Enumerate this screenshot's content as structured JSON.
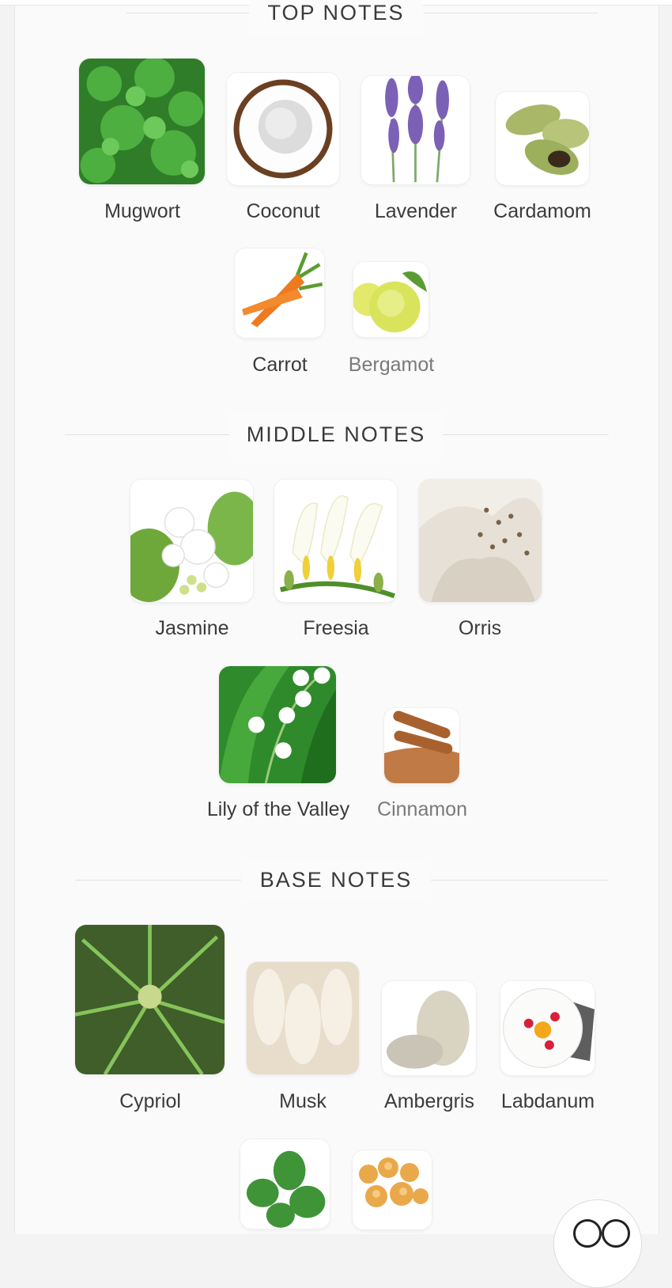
{
  "sections": {
    "top": {
      "title": "TOP NOTES",
      "notes": [
        {
          "name": "Mugwort",
          "icon": "mugwort-image"
        },
        {
          "name": "Coconut",
          "icon": "coconut-image"
        },
        {
          "name": "Lavender",
          "icon": "lavender-image"
        },
        {
          "name": "Cardamom",
          "icon": "cardamom-image"
        },
        {
          "name": "Carrot",
          "icon": "carrot-image"
        },
        {
          "name": "Bergamot",
          "icon": "bergamot-image"
        }
      ]
    },
    "middle": {
      "title": "MIDDLE NOTES",
      "notes": [
        {
          "name": "Jasmine",
          "icon": "jasmine-image"
        },
        {
          "name": "Freesia",
          "icon": "freesia-image"
        },
        {
          "name": "Orris",
          "icon": "orris-image"
        },
        {
          "name": "Lily of the Valley",
          "icon": "lily-of-the-valley-image"
        },
        {
          "name": "Cinnamon",
          "icon": "cinnamon-image"
        }
      ]
    },
    "base": {
      "title": "BASE NOTES",
      "notes": [
        {
          "name": "Cypriol",
          "icon": "cypriol-image"
        },
        {
          "name": "Musk",
          "icon": "musk-image"
        },
        {
          "name": "Ambergris",
          "icon": "ambergris-image"
        },
        {
          "name": "Labdanum",
          "icon": "labdanum-image"
        },
        {
          "name": "",
          "icon": "patchouli-leaf-image"
        },
        {
          "name": "",
          "icon": "resin-image"
        }
      ]
    }
  },
  "colors": {
    "text": "#3b3b3b",
    "muted": "#7a7a7a",
    "divider": "#e2e2e2"
  }
}
